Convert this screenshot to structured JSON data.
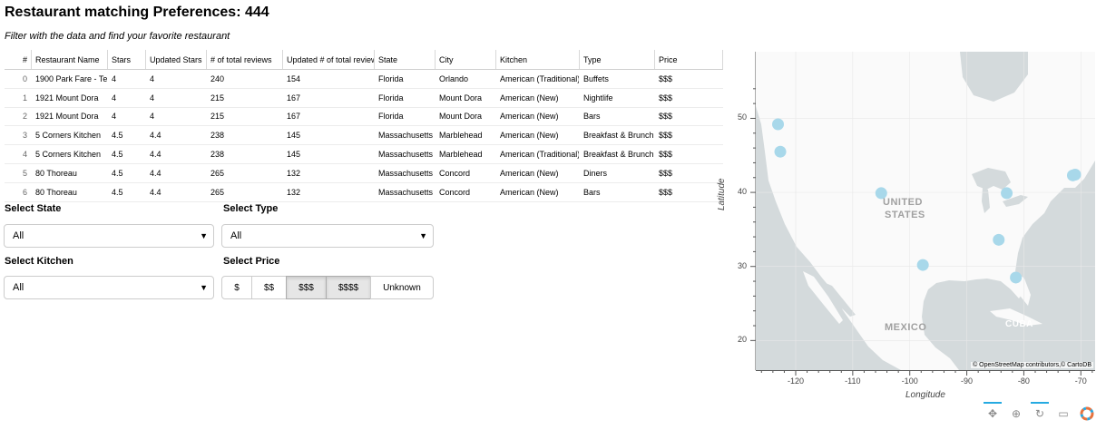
{
  "header": {
    "title": "Restaurant matching Preferences: 444",
    "subtitle": "Filter with the data and find your favorite restaurant"
  },
  "table": {
    "columns": [
      "#",
      "Restaurant Name",
      "Stars",
      "Updated Stars",
      "# of total reviews",
      "Updated # of total reviews",
      "State",
      "City",
      "Kitchen",
      "Type",
      "Price"
    ],
    "rows": [
      [
        "0",
        "1900 Park Fare - Te",
        "4",
        "4",
        "240",
        "154",
        "Florida",
        "Orlando",
        "American (Traditional)",
        "Buffets",
        "$$$"
      ],
      [
        "1",
        "1921 Mount Dora",
        "4",
        "4",
        "215",
        "167",
        "Florida",
        "Mount Dora",
        "American (New)",
        "Nightlife",
        "$$$"
      ],
      [
        "2",
        "1921 Mount Dora",
        "4",
        "4",
        "215",
        "167",
        "Florida",
        "Mount Dora",
        "American (New)",
        "Bars",
        "$$$"
      ],
      [
        "3",
        "5 Corners Kitchen",
        "4.5",
        "4.4",
        "238",
        "145",
        "Massachusetts",
        "Marblehead",
        "American (New)",
        "Breakfast & Brunch",
        "$$$"
      ],
      [
        "4",
        "5 Corners Kitchen",
        "4.5",
        "4.4",
        "238",
        "145",
        "Massachusetts",
        "Marblehead",
        "American (Traditional)",
        "Breakfast & Brunch",
        "$$$"
      ],
      [
        "5",
        "80 Thoreau",
        "4.5",
        "4.4",
        "265",
        "132",
        "Massachusetts",
        "Concord",
        "American (New)",
        "Diners",
        "$$$"
      ],
      [
        "6",
        "80 Thoreau",
        "4.5",
        "4.4",
        "265",
        "132",
        "Massachusetts",
        "Concord",
        "American (New)",
        "Bars",
        "$$$"
      ]
    ]
  },
  "filters": {
    "state": {
      "label": "Select State",
      "value": "All"
    },
    "type": {
      "label": "Select Type",
      "value": "All"
    },
    "kitchen": {
      "label": "Select Kitchen",
      "value": "All"
    },
    "price": {
      "label": "Select Price",
      "options": [
        "$",
        "$$",
        "$$$",
        "$$$$",
        "Unknown"
      ],
      "active": [
        "$$$",
        "$$$$"
      ]
    }
  },
  "map": {
    "xlabel": "Longitude",
    "ylabel": "Latitude",
    "xticks": [
      "-120",
      "-110",
      "-100",
      "-90",
      "-80",
      "-70"
    ],
    "yticks": [
      "20",
      "30",
      "40",
      "50"
    ],
    "xlim": [
      -127,
      -67.5
    ],
    "ylim": [
      16,
      59
    ],
    "place_labels": [
      "UNITED",
      "STATES",
      "MEXICO",
      "CUBA"
    ],
    "attribution": "© OpenStreetMap contributors,© CartoDB",
    "point_color": "#a8d8ea",
    "points": [
      {
        "lon": -123.1,
        "lat": 49.2
      },
      {
        "lon": -122.7,
        "lat": 45.5
      },
      {
        "lon": -105.0,
        "lat": 39.9
      },
      {
        "lon": -97.7,
        "lat": 30.2
      },
      {
        "lon": -84.4,
        "lat": 33.6
      },
      {
        "lon": -83.0,
        "lat": 39.9
      },
      {
        "lon": -81.4,
        "lat": 28.5
      },
      {
        "lon": -71.4,
        "lat": 42.3
      },
      {
        "lon": -71.0,
        "lat": 42.4
      }
    ]
  },
  "toolbar": {
    "tools": [
      "pan-icon",
      "wheel-zoom-icon",
      "reset-icon",
      "hover-icon",
      "bokeh-logo"
    ]
  }
}
